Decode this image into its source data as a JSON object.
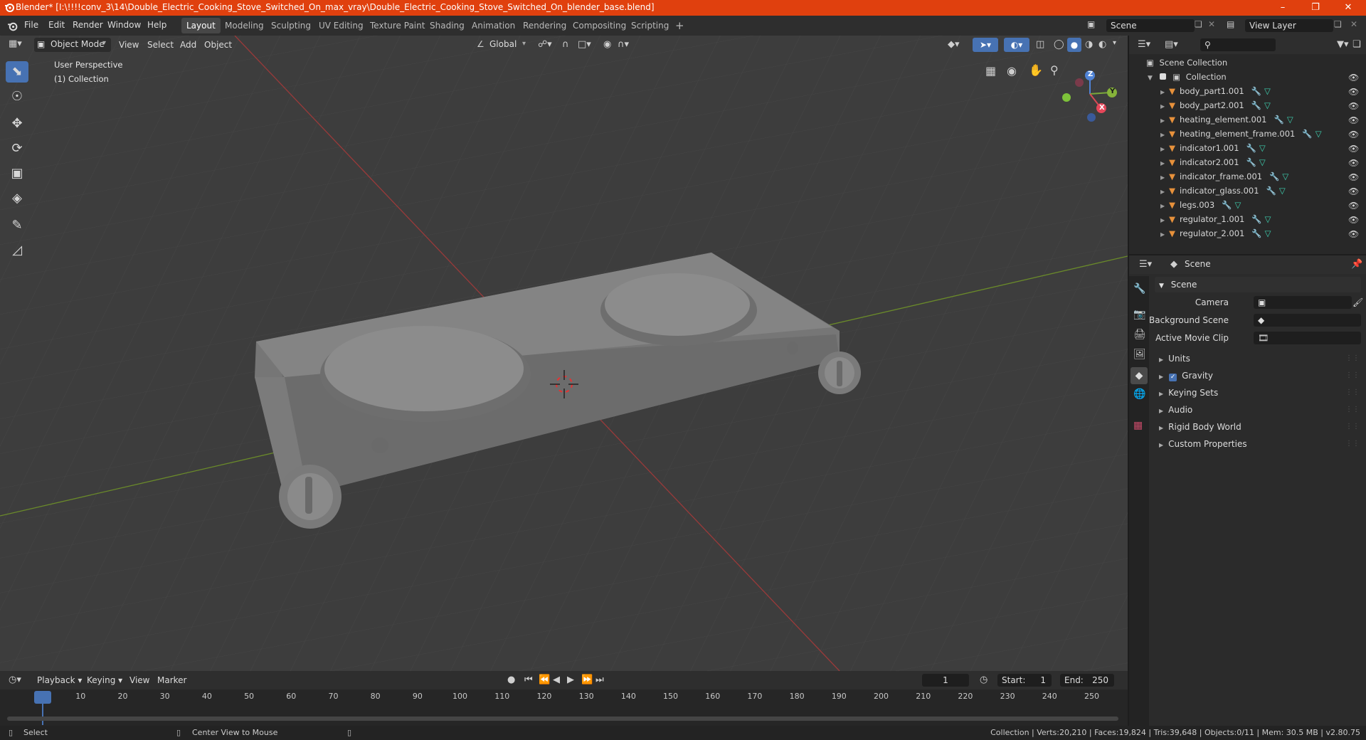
{
  "window": {
    "title": "Blender* [I:\\!!!!conv_3\\14\\Double_Electric_Cooking_Stove_Switched_On_max_vray\\Double_Electric_Cooking_Stove_Switched_On_blender_base.blend]",
    "minimize": "–",
    "maximize": "❐",
    "close": "✕"
  },
  "menu": [
    "File",
    "Edit",
    "Render",
    "Window",
    "Help"
  ],
  "workspaces": [
    "Layout",
    "Modeling",
    "Sculpting",
    "UV Editing",
    "Texture Paint",
    "Shading",
    "Animation",
    "Rendering",
    "Compositing",
    "Scripting"
  ],
  "workspace_add": "+",
  "scene_field": "Scene",
  "view_layer_field": "View Layer",
  "viewport": {
    "mode": "Object Mode",
    "menus": [
      "View",
      "Select",
      "Add",
      "Object"
    ],
    "orientation": "Global",
    "perspective": "User Perspective",
    "collection": "(1) Collection",
    "gizmo_axes": {
      "x": "X",
      "y": "Y",
      "z": "Z"
    }
  },
  "outliner": {
    "root": "Scene Collection",
    "collection": "Collection",
    "items": [
      "body_part1.001",
      "body_part2.001",
      "heating_element.001",
      "heating_element_frame.001",
      "indicator1.001",
      "indicator2.001",
      "indicator_frame.001",
      "indicator_glass.001",
      "legs.003",
      "regulator_1.001",
      "regulator_2.001"
    ]
  },
  "properties": {
    "header": "Scene",
    "panel": "Scene",
    "fields": [
      {
        "label": "Camera",
        "value": ""
      },
      {
        "label": "Background Scene",
        "value": ""
      },
      {
        "label": "Active Movie Clip",
        "value": ""
      }
    ],
    "subpanels": [
      "Units",
      "Gravity",
      "Keying Sets",
      "Audio",
      "Rigid Body World",
      "Custom Properties"
    ],
    "gravity_checked": true
  },
  "timeline": {
    "menus": [
      "Playback",
      "Keying",
      "View",
      "Marker"
    ],
    "current_frame": "1",
    "start_label": "Start:",
    "start": "1",
    "end_label": "End:",
    "end": "250",
    "ticks": [
      "1",
      "10",
      "20",
      "30",
      "40",
      "50",
      "60",
      "70",
      "80",
      "90",
      "100",
      "110",
      "120",
      "130",
      "140",
      "150",
      "160",
      "170",
      "180",
      "190",
      "200",
      "210",
      "220",
      "230",
      "240",
      "250"
    ]
  },
  "status": {
    "left": "Select",
    "middle": "Center View to Mouse",
    "right": "Collection | Verts:20,210 | Faces:19,824 | Tris:39,648 | Objects:0/11 | Mem: 30.5 MB | v2.80.75"
  }
}
